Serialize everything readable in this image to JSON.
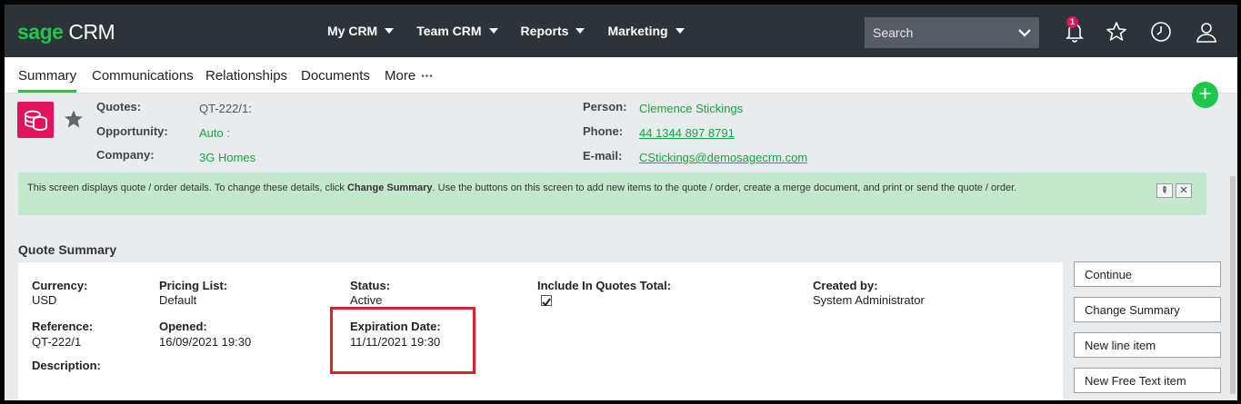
{
  "app": {
    "brand_prefix": "sage",
    "brand_suffix": " CRM"
  },
  "nav": [
    {
      "label": "My CRM"
    },
    {
      "label": "Team CRM"
    },
    {
      "label": "Reports"
    },
    {
      "label": "Marketing"
    }
  ],
  "search": {
    "placeholder": "Search"
  },
  "notifications": {
    "count": "1"
  },
  "tabs": {
    "summary": "Summary",
    "communications": "Communications",
    "relationships": "Relationships",
    "documents": "Documents",
    "more": "More"
  },
  "record": {
    "quotes_label": "Quotes:",
    "quotes_value": "QT-222/1:",
    "opportunity_label": "Opportunity:",
    "opportunity_value": "Auto :",
    "company_label": "Company:",
    "company_value": "3G Homes",
    "person_label": "Person:",
    "person_value": "Clemence Stickings",
    "phone_label": "Phone:",
    "phone_value": "44 1344 897 8791",
    "email_label": "E-mail:",
    "email_value": "CStickings@demosagecrm.com"
  },
  "banner": {
    "text_before": "This screen displays quote / order details. To change these details, click ",
    "bold": "Change Summary",
    "text_after": ". Use the buttons on this screen to add new items to the quote / order, create a merge document, and print or send the quote / order."
  },
  "summary": {
    "title": "Quote Summary",
    "currency_label": "Currency:",
    "currency_value": "USD",
    "pricing_label": "Pricing List:",
    "pricing_value": "Default",
    "status_label": "Status:",
    "status_value": "Active",
    "include_label": "Include In Quotes Total:",
    "include_checked": true,
    "created_label": "Created by:",
    "created_value": "System Administrator",
    "reference_label": "Reference:",
    "reference_value": "QT-222/1",
    "opened_label": "Opened:",
    "opened_value": "16/09/2021 19:30",
    "expiration_label": "Expiration Date:",
    "expiration_value": "11/11/2021 19:30",
    "description_label": "Description:"
  },
  "actions": {
    "continue": "Continue",
    "change_summary": "Change Summary",
    "new_line_item": "New line item",
    "new_free_text_item": "New Free Text item"
  },
  "colors": {
    "topbar": "#2c3339",
    "brand_green": "#1ec64c",
    "link_green": "#16a637",
    "banner_bg": "#c4e8cd",
    "record_icon": "#e0135e",
    "highlight": "#d9202e"
  },
  "icons": {
    "notifications": "bell-icon",
    "favorites": "star-icon",
    "recent": "clock-icon",
    "user": "user-icon",
    "record": "coins-icon",
    "add": "plus-icon"
  }
}
